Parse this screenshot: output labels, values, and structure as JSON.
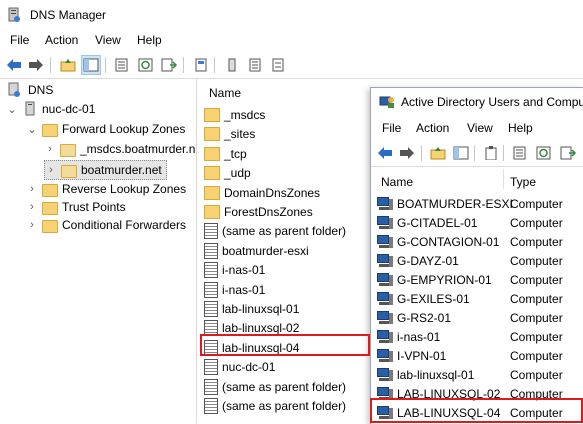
{
  "dns": {
    "title": "DNS Manager",
    "menu": [
      "File",
      "Action",
      "View",
      "Help"
    ],
    "tree": [
      {
        "label": "DNS",
        "level": 0,
        "arrow": "",
        "icon": "dns-server-icon"
      },
      {
        "label": "nuc-dc-01",
        "level": 1,
        "arrow": "⌄",
        "icon": "server-icon"
      },
      {
        "label": "Forward Lookup Zones",
        "level": 2,
        "arrow": "⌄",
        "icon": "folder-icon"
      },
      {
        "label": "_msdcs.boatmurder.n",
        "level": 3,
        "arrow": "›",
        "icon": "zone-icon"
      },
      {
        "label": "boatmurder.net",
        "level": 3,
        "arrow": "›",
        "icon": "zone-icon",
        "selected": true
      },
      {
        "label": "Reverse Lookup Zones",
        "level": 2,
        "arrow": "›",
        "icon": "folder-icon"
      },
      {
        "label": "Trust Points",
        "level": 2,
        "arrow": "›",
        "icon": "folder-icon"
      },
      {
        "label": "Conditional Forwarders",
        "level": 2,
        "arrow": "›",
        "icon": "folder-icon"
      }
    ],
    "list_header": "Name",
    "records": [
      {
        "label": "_msdcs",
        "icon": "folder-icon"
      },
      {
        "label": "_sites",
        "icon": "folder-icon"
      },
      {
        "label": "_tcp",
        "icon": "folder-icon"
      },
      {
        "label": "_udp",
        "icon": "folder-icon"
      },
      {
        "label": "DomainDnsZones",
        "icon": "folder-icon"
      },
      {
        "label": "ForestDnsZones",
        "icon": "folder-icon"
      },
      {
        "label": "(same as parent folder)",
        "icon": "record-icon"
      },
      {
        "label": "boatmurder-esxi",
        "icon": "record-icon"
      },
      {
        "label": "i-nas-01",
        "icon": "record-icon"
      },
      {
        "label": "i-nas-01",
        "icon": "record-icon"
      },
      {
        "label": "lab-linuxsql-01",
        "icon": "record-icon"
      },
      {
        "label": "lab-linuxsql-02",
        "icon": "record-icon"
      },
      {
        "label": "lab-linuxsql-04",
        "icon": "record-icon",
        "highlighted": true
      },
      {
        "label": "nuc-dc-01",
        "icon": "record-icon"
      },
      {
        "label": "(same as parent folder)",
        "icon": "record-icon"
      },
      {
        "label": "(same as parent folder)",
        "icon": "record-icon"
      }
    ]
  },
  "aduc": {
    "title": "Active Directory Users and Computers",
    "menu": [
      "File",
      "Action",
      "View",
      "Help"
    ],
    "columns": [
      "Name",
      "Type"
    ],
    "rows": [
      {
        "name": "BOATMURDER-ESXI",
        "type": "Computer"
      },
      {
        "name": "G-CITADEL-01",
        "type": "Computer"
      },
      {
        "name": "G-CONTAGION-01",
        "type": "Computer"
      },
      {
        "name": "G-DAYZ-01",
        "type": "Computer"
      },
      {
        "name": "G-EMPYRION-01",
        "type": "Computer"
      },
      {
        "name": "G-EXILES-01",
        "type": "Computer"
      },
      {
        "name": "G-RS2-01",
        "type": "Computer"
      },
      {
        "name": "i-nas-01",
        "type": "Computer"
      },
      {
        "name": "I-VPN-01",
        "type": "Computer"
      },
      {
        "name": "lab-linuxsql-01",
        "type": "Computer"
      },
      {
        "name": "LAB-LINUXSQL-02",
        "type": "Computer"
      },
      {
        "name": "LAB-LINUXSQL-04",
        "type": "Computer",
        "highlighted": true
      }
    ]
  },
  "colors": {
    "highlight_border": "#e0191f",
    "selection": "#e5e5e5",
    "folder": "#f6d274"
  }
}
